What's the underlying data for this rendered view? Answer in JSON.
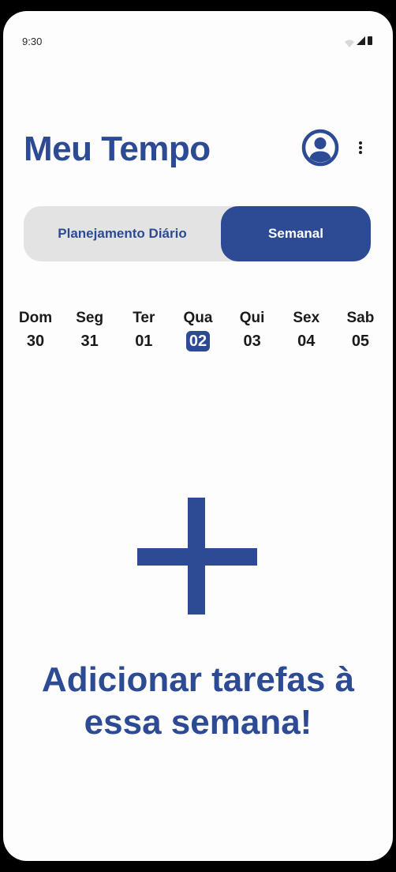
{
  "status_bar": {
    "time": "9:30"
  },
  "header": {
    "title": "Meu Tempo",
    "profile_icon": "account-circle-icon",
    "menu_icon": "more-vertical-icon"
  },
  "tabs": [
    {
      "label": "Planejamento Diário",
      "selected": false
    },
    {
      "label": "Semanal",
      "selected": true
    }
  ],
  "week": {
    "days": [
      {
        "name": "Dom",
        "number": "30",
        "selected": false
      },
      {
        "name": "Seg",
        "number": "31",
        "selected": false
      },
      {
        "name": "Ter",
        "number": "01",
        "selected": false
      },
      {
        "name": "Qua",
        "number": "02",
        "selected": true
      },
      {
        "name": "Qui",
        "number": "03",
        "selected": false
      },
      {
        "name": "Sex",
        "number": "04",
        "selected": false
      },
      {
        "name": "Sab",
        "number": "05",
        "selected": false
      }
    ]
  },
  "empty_state": {
    "icon": "plus-icon",
    "message_line1": "Adicionar tarefas à",
    "message_line2": "essa semana!"
  },
  "colors": {
    "accent": "#2c4b94",
    "segment_bg": "#e3e3e3",
    "background": "#fdfdfd"
  }
}
